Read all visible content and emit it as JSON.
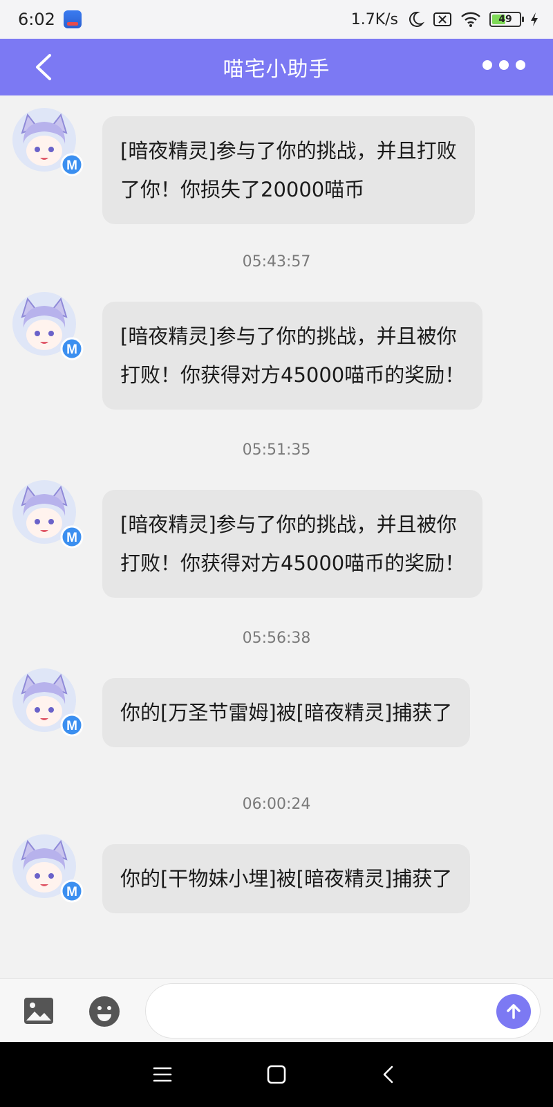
{
  "status_bar": {
    "time": "6:02",
    "network_speed": "1.7K/s",
    "battery_percent": "49",
    "battery_level": 0.49,
    "icons": [
      "app-notification-icon",
      "moon-icon",
      "sim-off-icon",
      "wifi-icon",
      "battery-icon",
      "charging-icon"
    ]
  },
  "header": {
    "title": "喵宅小助手",
    "back_icon": "chevron-left-icon",
    "more_icon": "more-dots-icon"
  },
  "colors": {
    "accent": "#7c79f3",
    "bubble": "#e6e6e6",
    "avatar_badge": "#3b8ff0"
  },
  "messages": [
    {
      "avatar_badge": "M",
      "lines": [
        "[暗夜精灵]参与了你的挑战，并且打败",
        "了你！你损失了20000喵币"
      ]
    },
    {
      "time": "05:43:57",
      "avatar_badge": "M",
      "lines": [
        "[暗夜精灵]参与了你的挑战，并且被你",
        "打败！你获得对方45000喵币的奖励！"
      ]
    },
    {
      "time": "05:51:35",
      "avatar_badge": "M",
      "lines": [
        "[暗夜精灵]参与了你的挑战，并且被你",
        "打败！你获得对方45000喵币的奖励！"
      ]
    },
    {
      "time": "05:56:38",
      "avatar_badge": "M",
      "lines": [
        "你的[万圣节雷姆]被[暗夜精灵]捕获了"
      ]
    },
    {
      "time": "06:00:24",
      "avatar_badge": "M",
      "lines": [
        "你的[干物妹小埋]被[暗夜精灵]捕获了"
      ]
    }
  ],
  "input_bar": {
    "image_icon": "image-icon",
    "emoji_icon": "emoji-icon",
    "input_value": "",
    "input_placeholder": "",
    "send_icon": "send-arrow-up-icon"
  },
  "nav_bar": {
    "icons": [
      "menu-icon",
      "home-square-icon",
      "back-chevron-icon"
    ]
  }
}
